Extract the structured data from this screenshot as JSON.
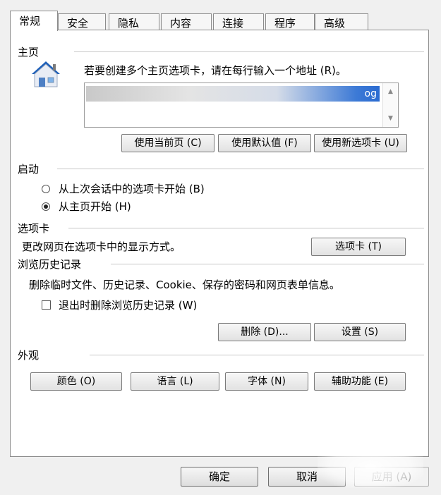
{
  "tabs": [
    {
      "label": "常规",
      "active": true
    },
    {
      "label": "安全"
    },
    {
      "label": "隐私"
    },
    {
      "label": "内容"
    },
    {
      "label": "连接"
    },
    {
      "label": "程序"
    },
    {
      "label": "高级"
    }
  ],
  "home": {
    "title": "主页",
    "instruction": "若要创建多个主页选项卡，请在每行输入一个地址 (R)。",
    "address_fragment": "og",
    "buttons": {
      "use_current": "使用当前页 (C)",
      "use_default": "使用默认值 (F)",
      "use_new_tab": "使用新选项卡 (U)"
    }
  },
  "startup": {
    "title": "启动",
    "options": [
      {
        "label": "从上次会话中的选项卡开始 (B)",
        "checked": false
      },
      {
        "label": "从主页开始 (H)",
        "checked": true
      }
    ]
  },
  "tabs_section": {
    "title": "选项卡",
    "description": "更改网页在选项卡中的显示方式。",
    "button": "选项卡 (T)"
  },
  "history": {
    "title": "浏览历史记录",
    "description": "删除临时文件、历史记录、Cookie、保存的密码和网页表单信息。",
    "checkbox_label": "退出时删除浏览历史记录 (W)",
    "checkbox_checked": false,
    "delete_button": "删除 (D)...",
    "settings_button": "设置 (S)"
  },
  "appearance": {
    "title": "外观",
    "buttons": [
      "颜色 (O)",
      "语言 (L)",
      "字体 (N)",
      "辅助功能 (E)"
    ]
  },
  "footer": {
    "ok": "确定",
    "cancel": "取消",
    "apply": "应用 (A)"
  },
  "colors": {
    "home_icon_roof": "#1d5fb8",
    "home_icon_wall": "#e9edf5"
  },
  "icons": {
    "home": "home-icon",
    "scroll_up": "scroll-up-arrow-icon",
    "scroll_down": "scroll-down-arrow-icon"
  }
}
